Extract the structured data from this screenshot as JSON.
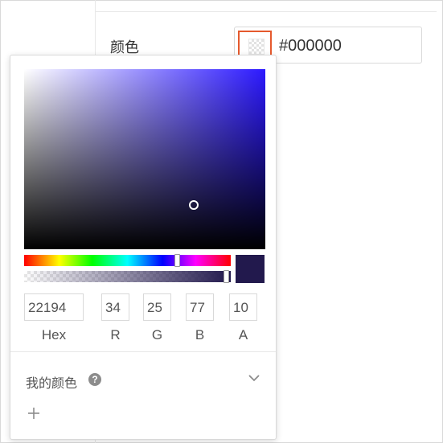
{
  "form": {
    "color_label": "颜色",
    "hex_value": "#000000",
    "swatch_icon": "transparent-checker-icon"
  },
  "picker": {
    "current_color": "#22194d",
    "hue_color": "#2c19ff",
    "hue_level": 0.74,
    "alpha_level": 0.98,
    "hex_input": "22194",
    "r_input": "34",
    "g_input": "25",
    "b_input": "77",
    "a_input": "10",
    "labels": {
      "hex": "Hex",
      "r": "R",
      "g": "G",
      "b": "B",
      "a": "A"
    },
    "my_colors_label": "我的颜色",
    "help_icon_glyph": "?",
    "expand_icon": "chevron-down-icon",
    "add_icon": "plus-icon"
  },
  "accent_color": "#e5592d"
}
